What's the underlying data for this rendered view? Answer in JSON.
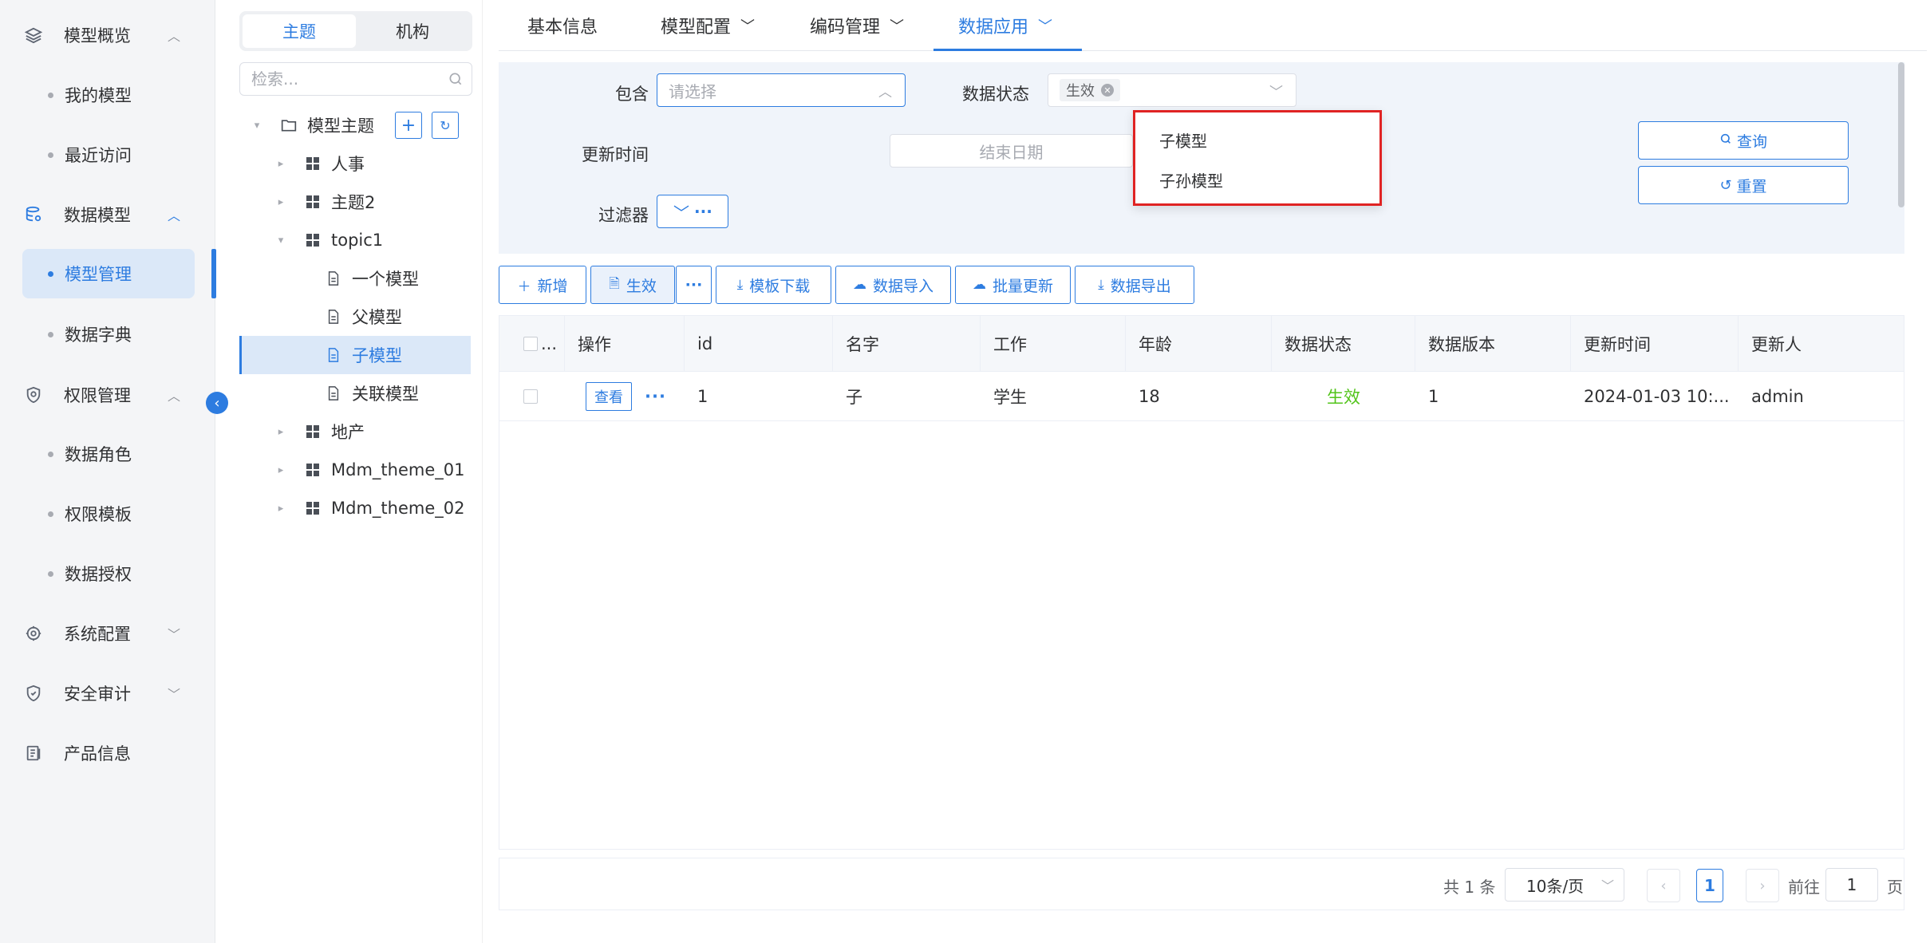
{
  "sidebar": {
    "groups": [
      {
        "label": "模型概览",
        "icon": "layers-icon"
      },
      {
        "label": "数据模型",
        "icon": "database-icon"
      },
      {
        "label": "权限管理",
        "icon": "shield-icon"
      },
      {
        "label": "系统配置",
        "icon": "settings-icon"
      },
      {
        "label": "安全审计",
        "icon": "audit-shield-icon"
      },
      {
        "label": "产品信息",
        "icon": "document-icon"
      }
    ],
    "items": {
      "my_models": "我的模型",
      "recent": "最近访问",
      "model_mgmt": "模型管理",
      "data_dict": "数据字典",
      "data_role": "数据角色",
      "perm_template": "权限模板",
      "data_auth": "数据授权"
    }
  },
  "tree": {
    "seg_topic": "主题",
    "seg_org": "机构",
    "search_placeholder": "检索...",
    "root": "模型主题",
    "nodes": {
      "renshi": "人事",
      "zhuti2": "主题2",
      "topic1": "topic1",
      "yige": "一个模型",
      "fu": "父模型",
      "zi": "子模型",
      "guanlian": "关联模型",
      "dichan": "地产",
      "theme01": "Mdm_theme_01",
      "theme02": "Mdm_theme_02"
    }
  },
  "tabs": {
    "basic": "基本信息",
    "config": "模型配置",
    "code": "编码管理",
    "app": "数据应用"
  },
  "filter": {
    "contains_label": "包含",
    "contains_placeholder": "请选择",
    "status_label": "数据状态",
    "status_tag": "生效",
    "update_time_label": "更新时间",
    "end_date_placeholder": "结束日期",
    "filter_label": "过滤器",
    "query": "查询",
    "reset": "重置",
    "dropdown_options": [
      "子模型",
      "子孙模型"
    ]
  },
  "toolbar": {
    "add": "新增",
    "effective": "生效",
    "template_download": "模板下载",
    "data_import": "数据导入",
    "batch_update": "批量更新",
    "data_export": "数据导出"
  },
  "table": {
    "headers": {
      "select": "...",
      "op": "操作",
      "id": "id",
      "name": "名字",
      "work": "工作",
      "age": "年龄",
      "status": "数据状态",
      "version": "数据版本",
      "updated": "更新时间",
      "updater": "更新人"
    },
    "rows": [
      {
        "view": "查看",
        "id": "1",
        "name": "子",
        "work": "学生",
        "age": "18",
        "status": "生效",
        "version": "1",
        "updated": "2024-01-03 10:...",
        "updater": "admin"
      }
    ]
  },
  "pagination": {
    "total": "共 1 条",
    "page_size": "10条/页",
    "current": "1",
    "goto_label": "前往",
    "goto_value": "1",
    "page_unit": "页"
  },
  "colors": {
    "primary": "#2d7ce0",
    "success": "#52c41a",
    "highlight": "#e02323"
  }
}
